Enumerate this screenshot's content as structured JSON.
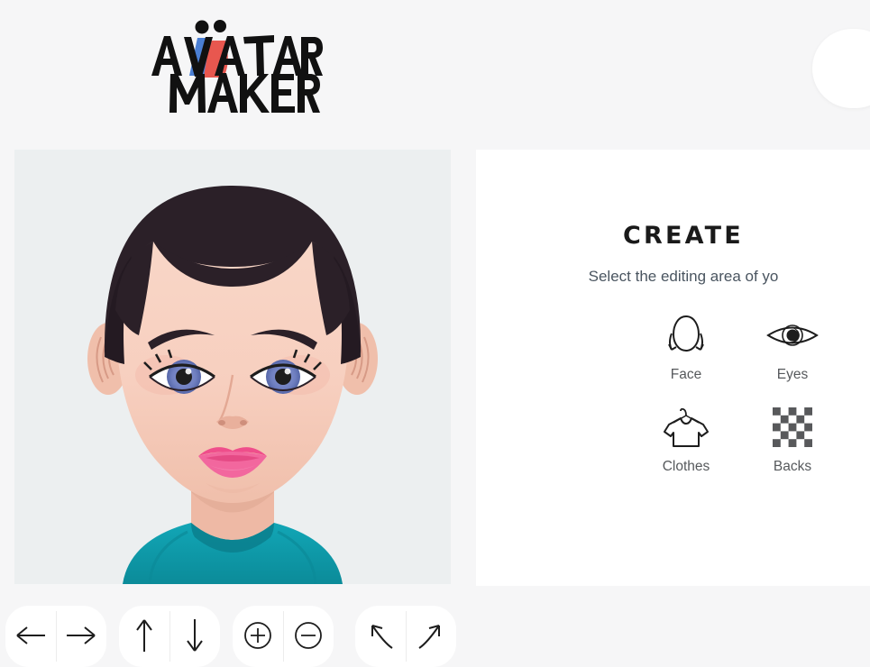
{
  "app": {
    "logo_line1": "AVATAR",
    "logo_line2": "MAKER",
    "logo_colors": {
      "blue": "#4a7fd4",
      "red": "#e8574f",
      "ink": "#111111"
    },
    "background": "#f6f6f7"
  },
  "panel": {
    "title": "CREATE",
    "subtitle": "Select the editing area of yo",
    "background": "#ffffff",
    "categories": [
      {
        "label": "Face",
        "icon": "face-icon"
      },
      {
        "label": "Eyes",
        "icon": "eyes-icon"
      },
      {
        "label": "",
        "icon": ""
      },
      {
        "label": "Clothes",
        "icon": "clothes-icon"
      },
      {
        "label": "Backs",
        "icon": "backgrounds-icon"
      }
    ]
  },
  "canvas": {
    "background": "#eceff0",
    "avatar": {
      "hair_color": "#2b2028",
      "skin_color": "#f7cfbf",
      "skin_shadow": "#e9b5a3",
      "eye_color": "#6f7fc0",
      "eye_dark": "#232323",
      "lips_color": "#f2558f",
      "lips_light": "#f78cb4",
      "shirt_color": "#0f9dae",
      "shirt_shadow": "#0b7f8e",
      "brow_color": "#2b2028"
    }
  },
  "toolbar": {
    "groups": [
      {
        "name": "move-horizontal",
        "buttons": [
          {
            "label": "move-left",
            "icon": "arrow-left-icon"
          },
          {
            "label": "move-right",
            "icon": "arrow-right-icon"
          }
        ]
      },
      {
        "name": "move-vertical",
        "buttons": [
          {
            "label": "move-up",
            "icon": "arrow-up-icon"
          },
          {
            "label": "move-down",
            "icon": "arrow-down-icon"
          }
        ]
      },
      {
        "name": "zoom",
        "buttons": [
          {
            "label": "zoom-in",
            "icon": "plus-circle-icon"
          },
          {
            "label": "zoom-out",
            "icon": "minus-circle-icon"
          }
        ]
      },
      {
        "name": "rotate",
        "buttons": [
          {
            "label": "rotate-left",
            "icon": "curved-arrow-up-left-icon"
          },
          {
            "label": "rotate-right",
            "icon": "curved-arrow-up-right-icon"
          }
        ]
      }
    ]
  }
}
